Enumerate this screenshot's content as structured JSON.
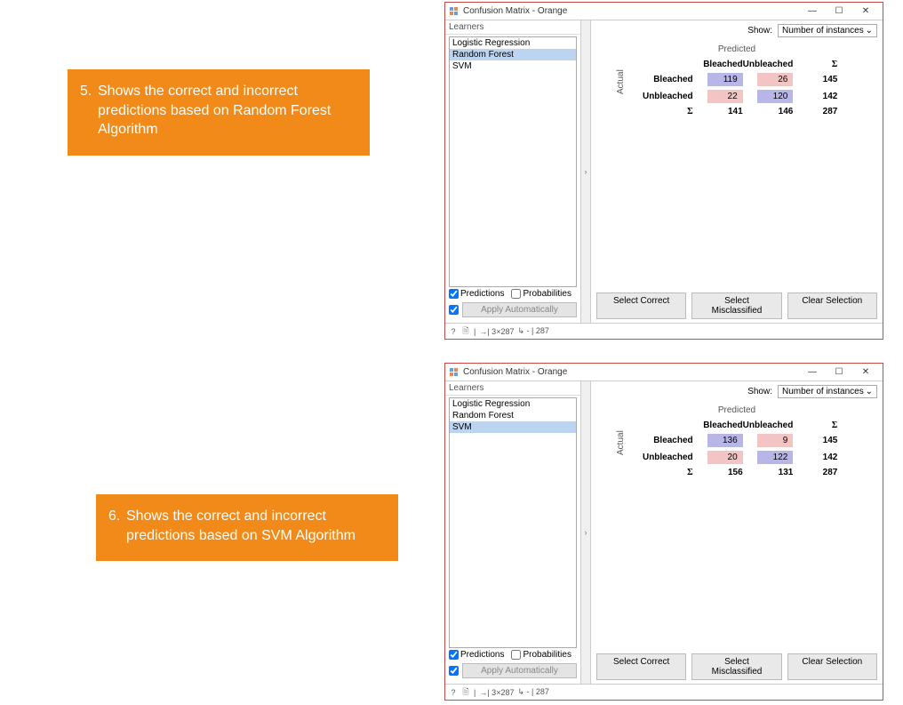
{
  "callouts": {
    "c1": {
      "num": "5.",
      "text": "Shows the correct and incorrect predictions based on Random Forest Algorithm"
    },
    "c2": {
      "num": "6.",
      "text": "Shows the correct and incorrect predictions based on SVM Algorithm"
    }
  },
  "window": {
    "title": "Confusion Matrix - Orange",
    "min": "—",
    "max": "☐",
    "close": "✕"
  },
  "learners_label": "Learners",
  "learners": {
    "items": [
      "Logistic Regression",
      "Random Forest",
      "SVM"
    ]
  },
  "show_label": "Show:",
  "show_value": "Number of instances",
  "predicted_label": "Predicted",
  "actual_label": "Actual",
  "headers": {
    "col1": "Bleached",
    "col2": "Unbleached",
    "sum": "Σ"
  },
  "rows": {
    "r1": "Bleached",
    "r2": "Unbleached",
    "sum": "Σ"
  },
  "matrix1": {
    "r1c1": "119",
    "r1c2": "26",
    "r1s": "145",
    "r2c1": "22",
    "r2c2": "120",
    "r2s": "142",
    "sc1": "141",
    "sc2": "146",
    "ss": "287"
  },
  "matrix2": {
    "r1c1": "136",
    "r1c2": "9",
    "r1s": "145",
    "r2c1": "20",
    "r2c2": "122",
    "r2s": "142",
    "sc1": "156",
    "sc2": "131",
    "ss": "287"
  },
  "checkboxes": {
    "predictions": "Predictions",
    "probabilities": "Probabilities"
  },
  "apply": "Apply Automatically",
  "buttons": {
    "correct": "Select Correct",
    "misclass": "Select Misclassified",
    "clear": "Clear Selection"
  },
  "status": {
    "info": "?",
    "doc": "🗎",
    "in": "→| 3×287",
    "out": "↳ - | 287"
  },
  "collapse": "›"
}
